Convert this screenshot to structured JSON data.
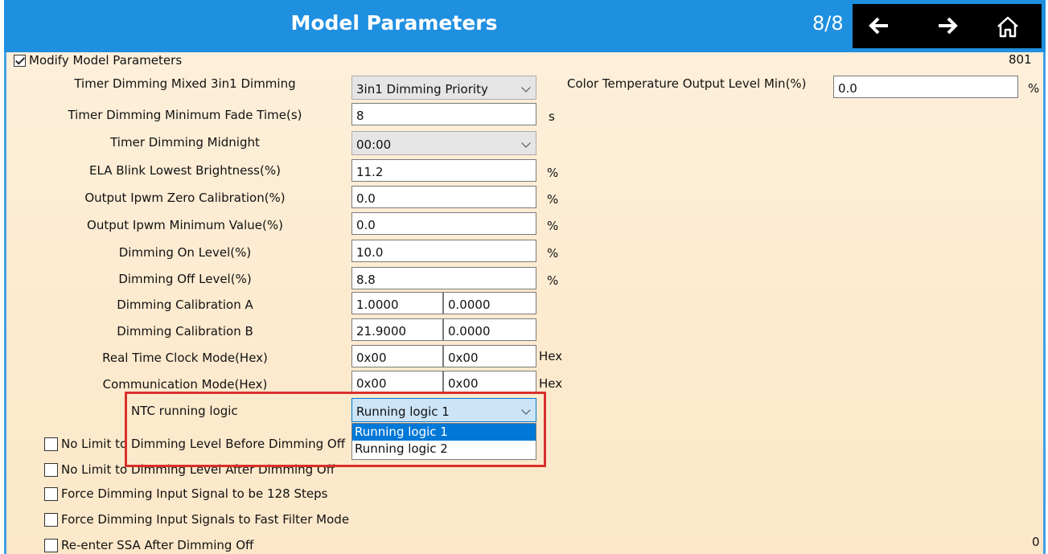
{
  "window": {
    "title": "Model Parameters",
    "page_indicator": "8/8"
  },
  "nav": {
    "back_icon": "arrow-left-icon",
    "forward_icon": "arrow-right-icon",
    "home_icon": "home-icon"
  },
  "modify": {
    "label": "Modify Model Parameters",
    "checked": true,
    "code": "801"
  },
  "params": [
    {
      "label": "Timer Dimming Mixed 3in1 Dimming",
      "type": "select",
      "value": "3in1 Dimming Priority"
    },
    {
      "label": "Timer Dimming Minimum Fade Time(s)",
      "type": "input",
      "value": "8",
      "unit": "s"
    },
    {
      "label": "Timer Dimming Midnight",
      "type": "select",
      "value": "00:00"
    },
    {
      "label": "ELA Blink Lowest Brightness(%)",
      "type": "input",
      "value": "11.2",
      "unit": "%"
    },
    {
      "label": "Output Ipwm Zero Calibration(%)",
      "type": "input",
      "value": "0.0",
      "unit": "%"
    },
    {
      "label": "Output Ipwm Minimum Value(%)",
      "type": "input",
      "value": "0.0",
      "unit": "%"
    },
    {
      "label": "Dimming On Level(%)",
      "type": "input",
      "value": "10.0",
      "unit": "%"
    },
    {
      "label": "Dimming Off Level(%)",
      "type": "input",
      "value": "8.8",
      "unit": "%"
    },
    {
      "label": "Dimming Calibration A",
      "type": "pair",
      "value1": "1.0000",
      "value2": "0.0000"
    },
    {
      "label": "Dimming Calibration B",
      "type": "pair",
      "value1": "21.9000",
      "value2": "0.0000"
    },
    {
      "label": "Real Time Clock Mode(Hex)",
      "type": "pair",
      "value1": "0x00",
      "value2": "0x00",
      "unit": "Hex"
    },
    {
      "label": "Communication Mode(Hex)",
      "type": "pair",
      "value1": "0x00",
      "value2": "0x00",
      "unit": "Hex"
    },
    {
      "label": "NTC running logic",
      "type": "select",
      "value": "Running logic 1"
    }
  ],
  "ntc_dropdown": {
    "options": [
      "Running logic 1",
      "Running logic 2"
    ],
    "highlighted": 0
  },
  "color_temp": {
    "label": "Color Temperature Output Level Min(%)",
    "value": "0.0",
    "unit": "%"
  },
  "checkboxes": [
    {
      "label": "No Limit to Dimming Level Before Dimming Off",
      "checked": false
    },
    {
      "label": "No Limit to Dimming Level After Dimming Off",
      "checked": false
    },
    {
      "label": "Force Dimming Input Signal to be 128 Steps",
      "checked": false
    },
    {
      "label": "Force Dimming Input Signals to Fast Filter Mode",
      "checked": false
    },
    {
      "label": "Re-enter SSA After Dimming Off",
      "checked": false
    }
  ],
  "footer_code": "0",
  "colors": {
    "title_bar": "#1f8fe0",
    "nav_block": "#000000",
    "highlight_box": "#d9302b",
    "selection": "#0078d7"
  }
}
